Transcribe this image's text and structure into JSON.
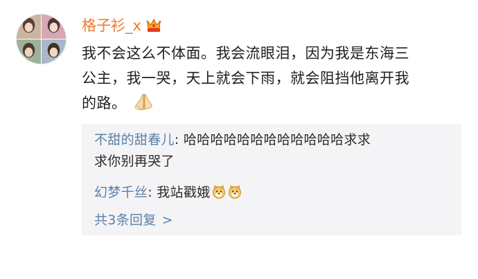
{
  "post": {
    "username": "格子衫_x",
    "crown_badge_icon": "vip-crown-icon",
    "text_lines": [
      "我不会这么不体面。我会流眼泪，因为我是东海三",
      "公主，我一哭，天上就会下雨，就会阻挡他离开我",
      "的路。"
    ],
    "emoji_icon": "pray-hands-icon"
  },
  "replies": [
    {
      "author": "不甜的甜春儿",
      "separator": ": ",
      "text_first": "哈哈哈哈哈哈哈哈哈哈哈哈求求",
      "text_second": "求你别再哭了"
    },
    {
      "author": "幻梦千丝",
      "separator": ": ",
      "text_first": "我站戳娥",
      "emoji_icon": "doge-icon"
    }
  ],
  "more_replies": {
    "label": "共3条回复",
    "chevron": ">"
  },
  "colors": {
    "username": "#f0782d",
    "link": "#5b80a7",
    "reply_background": "#f4f4f6"
  }
}
